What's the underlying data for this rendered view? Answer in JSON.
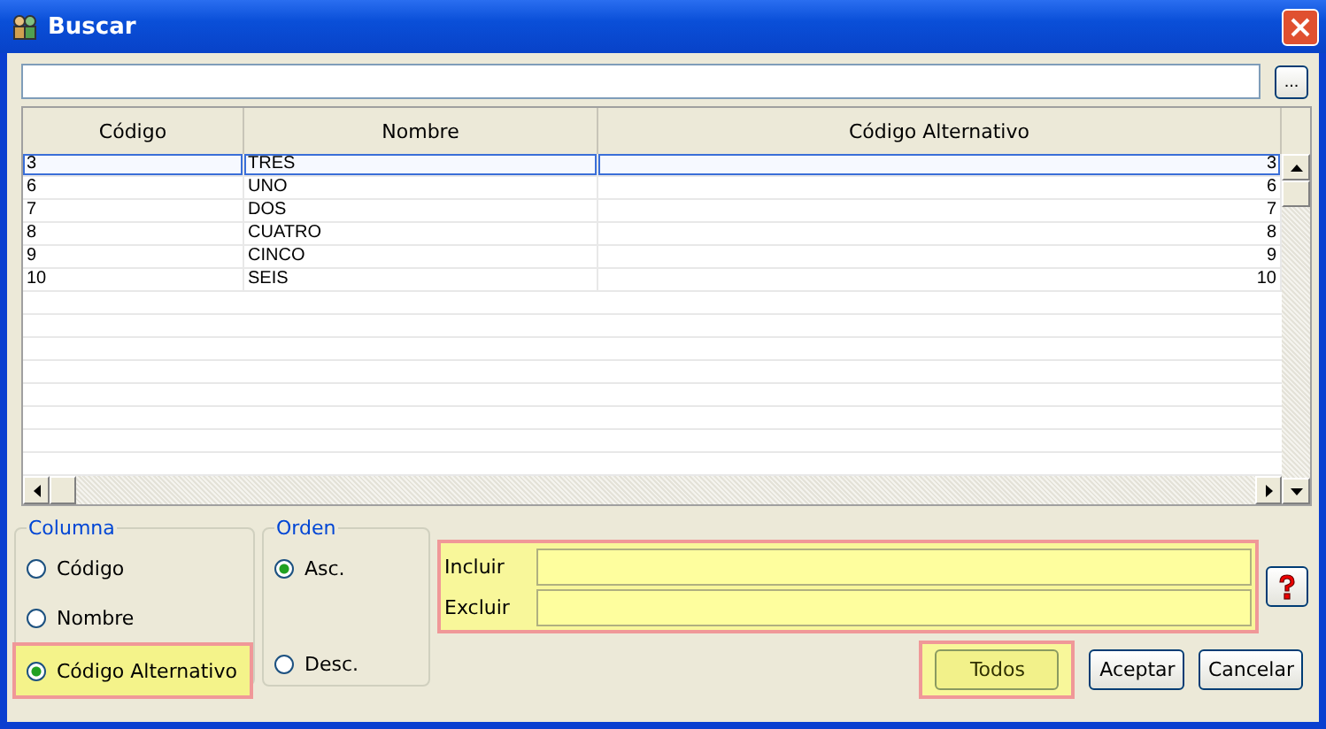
{
  "window": {
    "title": "Buscar"
  },
  "search": {
    "browse_button": "..."
  },
  "table": {
    "columns": [
      "Código",
      "Nombre",
      "Código Alternativo"
    ],
    "rows": [
      {
        "cells": [
          "3",
          "TRES",
          "3"
        ],
        "selected": true
      },
      {
        "cells": [
          "6",
          "UNO",
          "6"
        ],
        "selected": false
      },
      {
        "cells": [
          "7",
          "DOS",
          "7"
        ],
        "selected": false
      },
      {
        "cells": [
          "8",
          "CUATRO",
          "8"
        ],
        "selected": false
      },
      {
        "cells": [
          "9",
          "CINCO",
          "9"
        ],
        "selected": false
      },
      {
        "cells": [
          "10",
          "SEIS",
          "10"
        ],
        "selected": false
      }
    ]
  },
  "columna": {
    "title": "Columna",
    "options": [
      {
        "label": "Código",
        "selected": false
      },
      {
        "label": "Nombre",
        "selected": false
      },
      {
        "label": "Código Alternativo",
        "selected": true
      }
    ]
  },
  "orden": {
    "title": "Orden",
    "options": [
      {
        "label": "Asc.",
        "selected": true
      },
      {
        "label": "Desc.",
        "selected": false
      }
    ]
  },
  "filters": [
    {
      "label": "Incluir"
    },
    {
      "label": "Excluir"
    }
  ],
  "buttons": [
    {
      "label": "Todos",
      "highlighted": true
    },
    {
      "label": "Aceptar",
      "highlighted": false
    },
    {
      "label": "Cancelar",
      "highlighted": false
    }
  ]
}
